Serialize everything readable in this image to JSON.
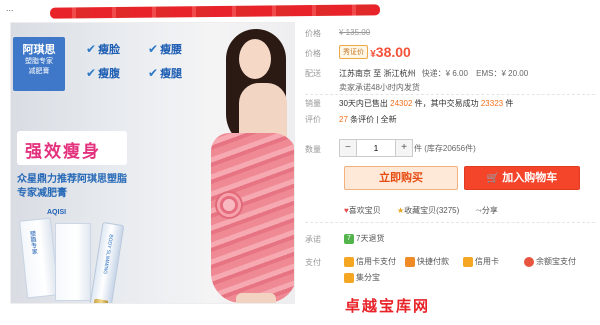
{
  "header": {
    "title_fragment": "..."
  },
  "image_text": {
    "brand_badge": "阿琪思",
    "badge_line1": "塑脂专家",
    "badge_line2": "减肥膏",
    "features": [
      "瘦脸",
      "瘦腰",
      "瘦腹",
      "瘦腿"
    ],
    "feature_prefix": "瘦",
    "headline": "强效瘦身",
    "sub_line1": "众星鼎力推荐阿琪思塑脂",
    "sub_line2": "专家减肥膏",
    "brand_small": "AQISI",
    "box_text": "塑脂专家",
    "tube_text": "BODY SLIMMING"
  },
  "price": {
    "label": "价格",
    "original": "¥ 135.00"
  },
  "promo": {
    "label": "价格",
    "tag": "秀证价",
    "currency": "¥",
    "value": "38.00"
  },
  "shipping": {
    "label": "配送",
    "route": "江苏南京 至  浙江杭州",
    "express": "快递：¥ 6.00",
    "ems": "EMS：¥ 20.00",
    "promise": "卖家承诺48小时内发货"
  },
  "sales": {
    "label": "销量",
    "text1": "30天内已售出",
    "count1": "24302",
    "unit1": "件，其中交易成功",
    "count2": "23323",
    "unit2": "件"
  },
  "reviews": {
    "label": "评价",
    "count": "27",
    "text": "条评价 | 全新"
  },
  "quantity": {
    "label": "数量",
    "minus": "−",
    "value": "1",
    "plus": "+",
    "stock": "件 (库存20656件)"
  },
  "actions": {
    "buy_now": "立即购买",
    "add_to_cart": "加入购物车"
  },
  "social": {
    "like": "喜欢宝贝",
    "collect": "收藏宝贝(3275)",
    "share": "分享"
  },
  "promise": {
    "label": "承诺",
    "badge": "7",
    "text": "7天退货"
  },
  "payment": {
    "label": "支付",
    "methods": [
      "信用卡支付",
      "快捷付款",
      "信用卡",
      "余额宝支付",
      "集分宝"
    ]
  },
  "watermark": {
    "text": "卓越宝库网"
  },
  "colors": {
    "accent_red": "#f4452a",
    "price_red": "#f4523a",
    "orange": "#f36f1b",
    "blue": "#1f5fb4",
    "pink": "#e4317d"
  }
}
